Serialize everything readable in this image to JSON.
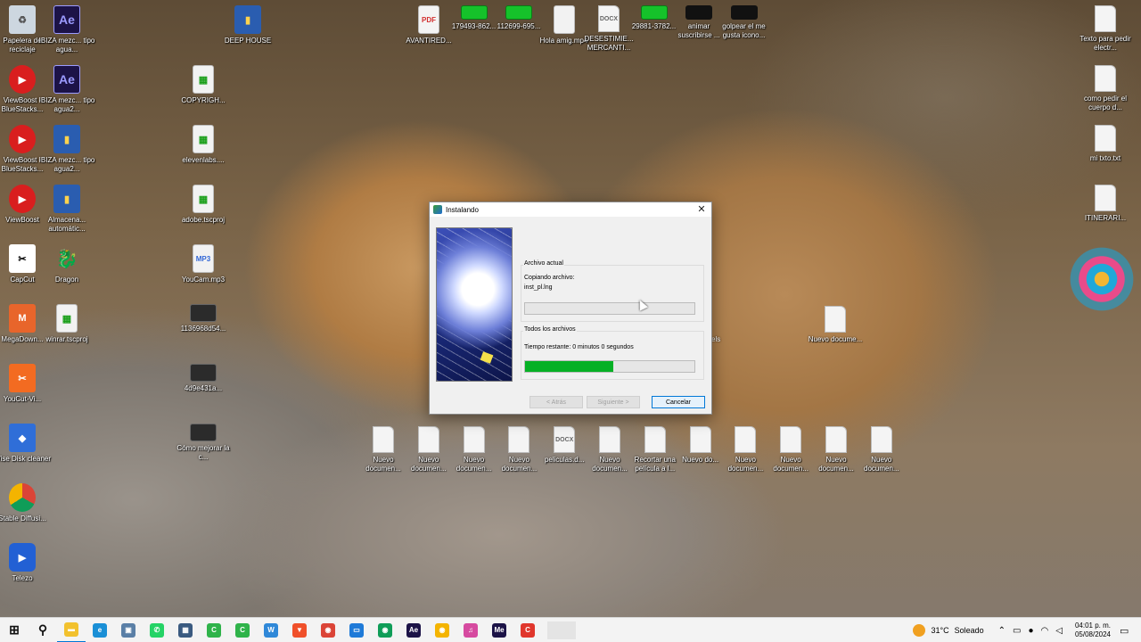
{
  "desktop": {
    "left_column": [
      {
        "label": "Papelera de reciclaje",
        "icon": "recycle-bin-icon",
        "glyph": "♻"
      },
      {
        "label": "ViewBoost - BlueStacks...",
        "icon": "viewboost-icon",
        "glyph": "▶"
      },
      {
        "label": "ViewBoost - BlueStacks...",
        "icon": "viewboost-icon",
        "glyph": "▶"
      },
      {
        "label": "ViewBoost",
        "icon": "viewboost-icon",
        "glyph": "▶"
      },
      {
        "label": "CapCut",
        "icon": "capcut-icon",
        "glyph": "✂"
      },
      {
        "label": "MegaDown...",
        "icon": "mega-icon",
        "glyph": "M"
      },
      {
        "label": "YouCut-Vi...",
        "icon": "youcut-icon",
        "glyph": "✂"
      },
      {
        "label": "Wise Disk cleaner",
        "icon": "wise-disk-icon",
        "glyph": "◆"
      },
      {
        "label": "Stable Diffusi...",
        "icon": "chrome-icon",
        "glyph": ""
      },
      {
        "label": "Telezo",
        "icon": "telezo-icon",
        "glyph": "▶"
      }
    ],
    "second_column": [
      {
        "label": "IBIZA mezc... tipo agua...",
        "icon": "after-effects-icon",
        "glyph": "Ae"
      },
      {
        "label": "IBIZA mezc... tipo agua2...",
        "icon": "after-effects-icon",
        "glyph": "Ae"
      },
      {
        "label": "IBIZA mezc... tipo agua2...",
        "icon": "book-icon",
        "glyph": "▮"
      },
      {
        "label": "Almacena... automátic...",
        "icon": "book-icon",
        "glyph": "▮"
      },
      {
        "label": "Dragon",
        "icon": "dragon-icon",
        "glyph": "🐉"
      },
      {
        "label": "winrar.tscproj",
        "icon": "video-project-icon",
        "glyph": "▦"
      }
    ],
    "third_column": [
      {
        "label": "COPYRIGH...",
        "icon": "video-project-icon",
        "glyph": "▦"
      },
      {
        "label": "elevenlabs....",
        "icon": "video-project-icon",
        "glyph": "▦"
      },
      {
        "label": "adobe.tscproj",
        "icon": "video-project-icon",
        "glyph": "▦"
      },
      {
        "label": "YouCam.mp3",
        "icon": "mp3-file-icon",
        "glyph": "MP3"
      },
      {
        "label": "1136968d54...",
        "icon": "video-thumbnail-icon",
        "glyph": ""
      },
      {
        "label": "4d9e431a...",
        "icon": "video-thumbnail-icon",
        "glyph": ""
      },
      {
        "label": "Cómo mejorar la c...",
        "icon": "video-thumbnail-icon",
        "glyph": ""
      }
    ],
    "deep_house": {
      "label": "DEEP HOUSE",
      "icon": "book-icon",
      "glyph": "▮"
    },
    "top_row": [
      {
        "label": "AVANTIRED...",
        "icon": "pdf-file-icon",
        "glyph": "PDF"
      },
      {
        "label": "179493-862...",
        "icon": "green-video-icon",
        "glyph": ""
      },
      {
        "label": "112699-695...",
        "icon": "green-video-icon",
        "glyph": ""
      },
      {
        "label": "Hola amig.mp4",
        "icon": "mp4-file-icon",
        "glyph": ""
      },
      {
        "label": "DESESTIMIE... MERCANTI...",
        "icon": "docx-file-icon",
        "glyph": "DOCX"
      },
      {
        "label": "29881-3782...",
        "icon": "green-video-icon",
        "glyph": ""
      },
      {
        "label": "animar suscribirse ...",
        "icon": "black-video-icon",
        "glyph": ""
      },
      {
        "label": "golpear el me gusta icono...",
        "icon": "black-video-icon",
        "glyph": ""
      }
    ],
    "right_column": [
      {
        "label": "Texto para pedir electr...",
        "icon": "text-file-icon",
        "glyph": ""
      },
      {
        "label": "como pedir el cuerpo d...",
        "icon": "text-file-icon",
        "glyph": ""
      },
      {
        "label": "mi txto.txt",
        "icon": "text-file-icon",
        "glyph": ""
      },
      {
        "label": "ITINERARI...",
        "icon": "text-file-icon",
        "glyph": ""
      }
    ],
    "middle_right": {
      "label": "Nuevo docume...",
      "icon": "text-file-icon",
      "glyph": ""
    },
    "partial_label": "els",
    "bottom_row": [
      {
        "label": "Nuevo documen...",
        "icon": "text-file-icon",
        "glyph": ""
      },
      {
        "label": "Nuevo documen...",
        "icon": "text-file-icon",
        "glyph": ""
      },
      {
        "label": "Nuevo documen...",
        "icon": "text-file-icon",
        "glyph": ""
      },
      {
        "label": "Nuevo documen...",
        "icon": "text-file-icon",
        "glyph": ""
      },
      {
        "label": "peliculas.d...",
        "icon": "docx-file-icon",
        "glyph": "DOCX"
      },
      {
        "label": "Nuevo documen...",
        "icon": "text-file-icon",
        "glyph": ""
      },
      {
        "label": "Recortar una película a l...",
        "icon": "text-file-icon",
        "glyph": ""
      },
      {
        "label": "Nuevo do...",
        "icon": "text-file-icon",
        "glyph": ""
      },
      {
        "label": "Nuevo documen...",
        "icon": "text-file-icon",
        "glyph": ""
      },
      {
        "label": "Nuevo documen...",
        "icon": "text-file-icon",
        "glyph": ""
      },
      {
        "label": "Nuevo documen...",
        "icon": "text-file-icon",
        "glyph": ""
      },
      {
        "label": "Nuevo documen...",
        "icon": "text-file-icon",
        "glyph": ""
      }
    ]
  },
  "dialog": {
    "title": "Instalando",
    "close_glyph": "✕",
    "current_file_group": {
      "title": "Archivo actual",
      "line1": "Copiando archivo:",
      "line2": "inst_pl.lng",
      "progress": 0
    },
    "all_files_group": {
      "title": "Todos los archivos",
      "line1": "Tiempo restante: 0 minutos 0 segundos",
      "progress": 0.52
    },
    "buttons": {
      "back": "< Atrás",
      "next": "Siguiente >",
      "cancel": "Cancelar"
    }
  },
  "taskbar": {
    "start_glyph": "⊞",
    "search_glyph": "⚲",
    "apps": [
      {
        "name": "file-explorer-icon",
        "color": "#f2c12e",
        "glyph": "▬"
      },
      {
        "name": "edge-icon",
        "color": "#1a8fd6",
        "glyph": "e"
      },
      {
        "name": "app-icon-1",
        "color": "#5a7fa6",
        "glyph": "▣"
      },
      {
        "name": "whatsapp-icon",
        "color": "#25d366",
        "glyph": "✆"
      },
      {
        "name": "app-icon-2",
        "color": "#3a5a80",
        "glyph": "▦"
      },
      {
        "name": "camtasia-icon",
        "color": "#2fb34a",
        "glyph": "C"
      },
      {
        "name": "camtasia-icon-2",
        "color": "#2fb34a",
        "glyph": "C"
      },
      {
        "name": "word-w-icon",
        "color": "#2f88d8",
        "glyph": "W"
      },
      {
        "name": "brave-icon",
        "color": "#f0502a",
        "glyph": "▼"
      },
      {
        "name": "chrome-icon",
        "color": "#db4437",
        "glyph": "◉"
      },
      {
        "name": "remote-desktop-icon",
        "color": "#1f7ad8",
        "glyph": "▭"
      },
      {
        "name": "chrome-profile-icon",
        "color": "#0f9d58",
        "glyph": "◉"
      },
      {
        "name": "after-effects-icon",
        "color": "#1c1347",
        "glyph": "Ae"
      },
      {
        "name": "chrome-profile-icon-2",
        "color": "#f4b400",
        "glyph": "◉"
      },
      {
        "name": "headphones-icon",
        "color": "#d64aa0",
        "glyph": "♫"
      },
      {
        "name": "media-encoder-icon",
        "color": "#1c1347",
        "glyph": "Me"
      },
      {
        "name": "camtasia-red-icon",
        "color": "#e0362c",
        "glyph": "C"
      }
    ],
    "weather": {
      "temp": "31°C",
      "condition": "Soleado"
    },
    "tray_chevron": "⌃",
    "clock": {
      "time": "04:01 p. m.",
      "date": "05/08/2024"
    },
    "notif_glyph": "▭"
  }
}
